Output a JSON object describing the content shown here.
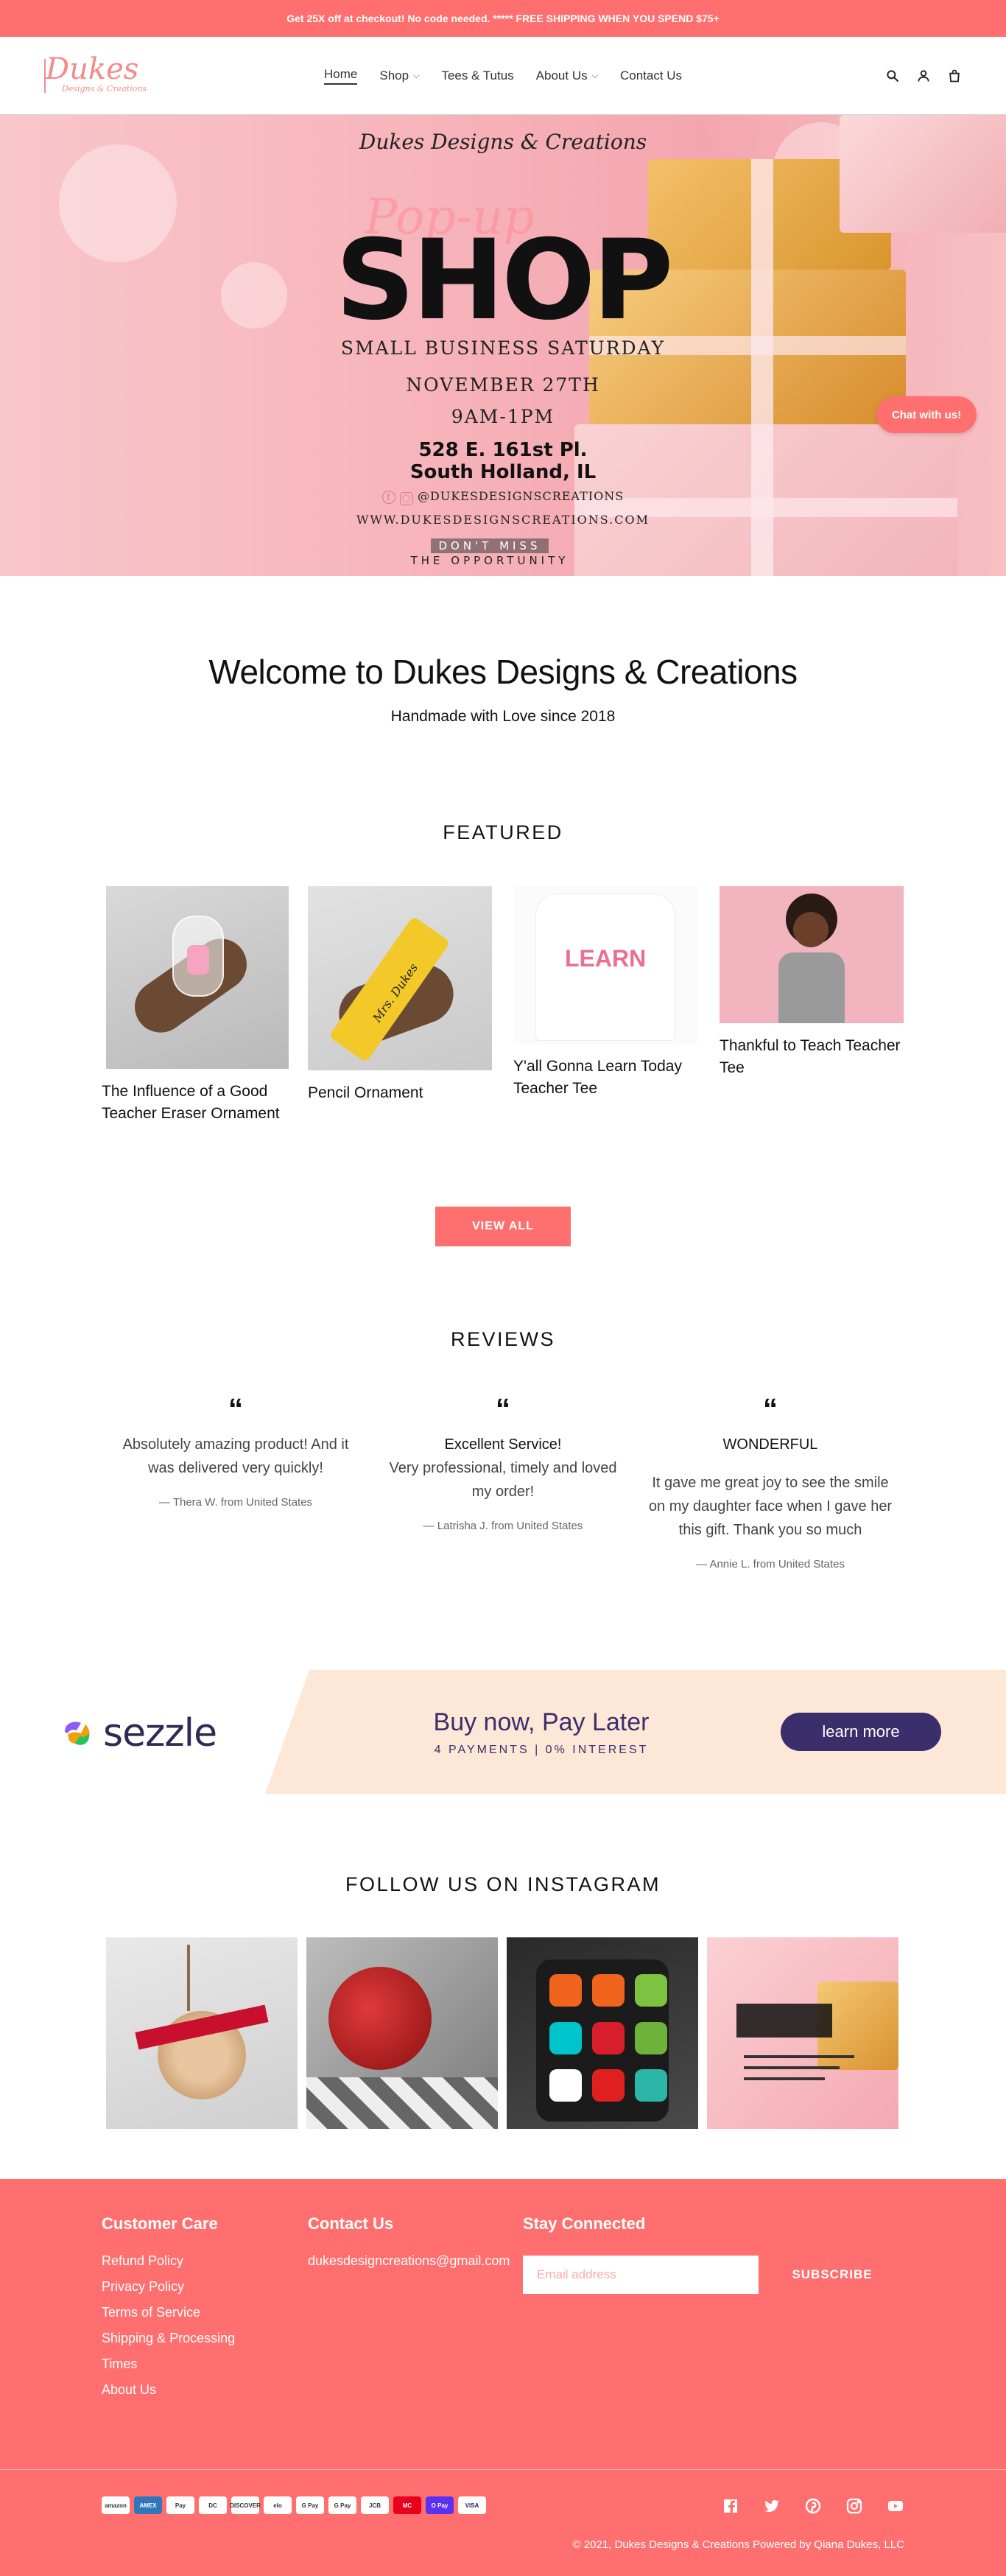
{
  "announcement": "Get 25X off at checkout! No code needed. ***** FREE SHIPPING WHEN YOU SPEND $75+",
  "logo": {
    "main": "Dukes",
    "sub": "Designs & Creations"
  },
  "nav": [
    {
      "label": "Home"
    },
    {
      "label": "Shop"
    },
    {
      "label": "Tees & Tutus"
    },
    {
      "label": "About Us"
    },
    {
      "label": "Contact Us"
    }
  ],
  "hero": {
    "brand": "Dukes Designs & Creations",
    "popup": "Pop-up",
    "shop": "SHOP",
    "event": "SMALL BUSINESS SATURDAY",
    "date": "NOVEMBER 27TH",
    "time": "9AM-1PM",
    "address1": "528 E. 161st Pl.",
    "address2": "South Holland, IL",
    "social": "@DUKESDESIGNSCREATIONS",
    "website": "WWW.DUKESDESIGNSCREATIONS.COM",
    "dontmiss1": "DON'T MISS",
    "dontmiss2": "THE OPPORTUNITY"
  },
  "chat": "Chat with us!",
  "welcome": {
    "title": "Welcome to Dukes Designs & Creations",
    "subtitle": "Handmade with Love since 2018"
  },
  "featured": {
    "title": "FEATURED",
    "products": [
      {
        "title": "The Influence of a Good Teacher Eraser Ornament"
      },
      {
        "title": "Pencil Ornament",
        "img_text": "Mrs. Dukes"
      },
      {
        "title": "Y'all Gonna Learn Today Teacher Tee",
        "img_text": "LEARN"
      },
      {
        "title": "Thankful to Teach Teacher Tee"
      }
    ],
    "view_all": "VIEW ALL"
  },
  "reviews": {
    "title": "REVIEWS",
    "items": [
      {
        "title": "",
        "body": "Absolutely amazing product! And it was delivered very quickly!",
        "author": "— Thera W. from United States"
      },
      {
        "title": "Excellent Service!",
        "body": "Very professional, timely and loved my order!",
        "author": "— Latrisha J. from United States"
      },
      {
        "title": "WONDERFUL",
        "body": "It gave me great joy to see the smile on my daughter face when I gave her this gift. Thank you so much",
        "author": "— Annie L. from United States"
      }
    ]
  },
  "sezzle": {
    "brand": "sezzle",
    "headline": "Buy now, Pay Later",
    "sub": "4 PAYMENTS | 0% INTEREST",
    "button": "learn more"
  },
  "instagram": {
    "title": "FOLLOW US ON INSTAGRAM"
  },
  "footer": {
    "care_title": "Customer Care",
    "care_links": [
      "Refund Policy",
      "Privacy Policy",
      "Terms of Service",
      "Shipping & Processing",
      "Times",
      "About Us"
    ],
    "contact_title": "Contact Us",
    "contact_email": "dukesdesigncreations@gmail.com",
    "stay_title": "Stay Connected",
    "email_placeholder": "Email address",
    "subscribe": "SUBSCRIBE",
    "payment": [
      "amazon",
      "AMEX",
      "Pay",
      "DC",
      "DISCOVER",
      "elo",
      "G Pay",
      "G Pay",
      "JCB",
      "MC",
      "O Pay",
      "VISA"
    ],
    "copyright": "© 2021, Dukes Designs & Creations Powered by Qiana Dukes, LLC"
  },
  "colors": {
    "accent": "#ff6f6f",
    "sezzle_purple": "#3b2f6b",
    "sezzle_band": "#fde8d8"
  }
}
